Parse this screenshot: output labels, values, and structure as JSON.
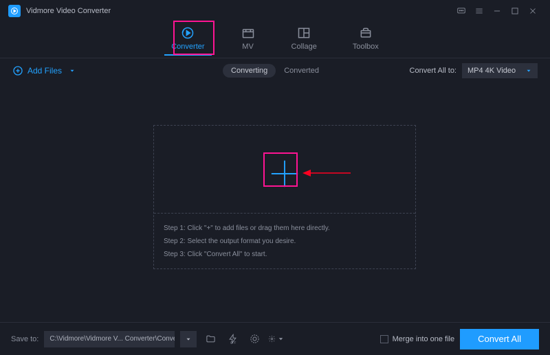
{
  "titlebar": {
    "title": "Vidmore Video Converter"
  },
  "tabs": {
    "converter": "Converter",
    "mv": "MV",
    "collage": "Collage",
    "toolbox": "Toolbox"
  },
  "subbar": {
    "add_files": "Add Files",
    "converting": "Converting",
    "converted": "Converted",
    "convert_all_to": "Convert All to:",
    "format_value": "MP4 4K Video"
  },
  "steps": {
    "s1": "Step 1: Click \"+\" to add files or drag them here directly.",
    "s2": "Step 2: Select the output format you desire.",
    "s3": "Step 3: Click \"Convert All\" to start."
  },
  "bottombar": {
    "save_to": "Save to:",
    "path": "C:\\Vidmore\\Vidmore V... Converter\\Converted",
    "merge_label": "Merge into one file",
    "convert_all": "Convert All"
  }
}
